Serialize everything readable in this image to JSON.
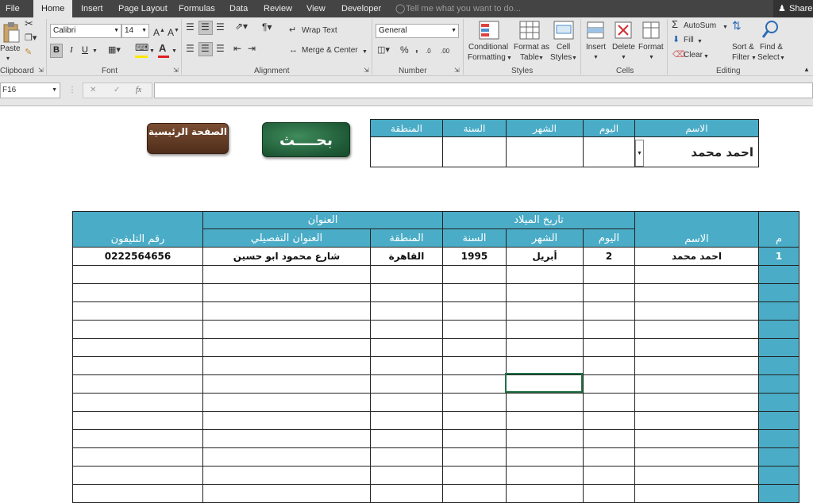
{
  "tabs": {
    "file": "File",
    "home": "Home",
    "insert": "Insert",
    "page_layout": "Page Layout",
    "formulas": "Formulas",
    "data": "Data",
    "review": "Review",
    "view": "View",
    "developer": "Developer"
  },
  "tell_me": "Tell me what you want to do...",
  "share": "Share",
  "ribbon": {
    "clipboard": {
      "paste": "Paste",
      "label": "Clipboard"
    },
    "font": {
      "name": "Calibri",
      "size": "14",
      "bold": "B",
      "italic": "I",
      "underline": "U",
      "label": "Font",
      "grow": "A",
      "shrink": "A",
      "color_letter": "A"
    },
    "alignment": {
      "wrap": "Wrap Text",
      "merge": "Merge & Center",
      "label": "Alignment"
    },
    "number": {
      "format": "General",
      "percent": "%",
      "comma": ",",
      "label": "Number",
      "dec_up": ".0",
      "dec_down": ".00"
    },
    "styles": {
      "conditional": "Conditional",
      "conditional2": "Formatting",
      "format_as": "Format as",
      "format_as2": "Table",
      "cell": "Cell",
      "cell2": "Styles",
      "label": "Styles"
    },
    "cells": {
      "insert": "Insert",
      "delete": "Delete",
      "format": "Format",
      "label": "Cells"
    },
    "editing": {
      "autosum": "AutoSum",
      "fill": "Fill",
      "clear": "Clear",
      "sort": "Sort &",
      "sort2": "Filter",
      "find": "Find &",
      "find2": "Select",
      "label": "Editing"
    }
  },
  "name_box": "F16",
  "fx": "fx",
  "accent": "#4aacc6",
  "search_panel": {
    "home_button": "الصفحة الرئيسية",
    "search_button": "بحــــث",
    "headers": {
      "region": "المنطقة",
      "year": "السنة",
      "month": "الشهر",
      "day": "اليوم",
      "name": "الاسم"
    },
    "name_value": "احمد محمد"
  },
  "table": {
    "h_phone": "رقم التليفون",
    "h_address": "العنوان",
    "h_address_detail": "العنوان التفصيلي",
    "h_region": "المنطقة",
    "h_birth": "تاريخ الميلاد",
    "h_year": "السنة",
    "h_month": "الشهر",
    "h_day": "اليوم",
    "h_name": "الاسم",
    "h_num": "م",
    "row1": {
      "phone": "0222564656",
      "address": "شارع محمود ابو حسين",
      "region": "القاهرة",
      "year": "1995",
      "month": "أبريل",
      "day": "2",
      "name": "احمد محمد",
      "num": "1"
    }
  }
}
